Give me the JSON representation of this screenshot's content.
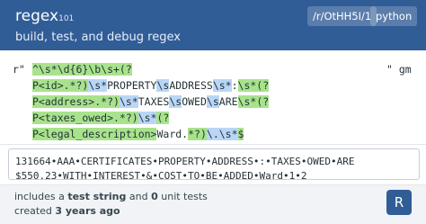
{
  "header": {
    "logo_main": "regex",
    "logo_sub": "101",
    "tagline": "build, test, and debug regex",
    "link_label": "/r/OtHH5I/1",
    "flavor_label": "python"
  },
  "regex": {
    "open_delim": "r\"",
    "flags": "\" gm",
    "lines": [
      [
        {
          "t": "^\\s*\\d{6}\\b\\s+(?",
          "c": "g"
        }
      ],
      [
        {
          "t": "P<id>.*?)",
          "c": "g"
        },
        {
          "t": "\\s*",
          "c": "b"
        },
        {
          "t": "PROPERTY",
          "c": ""
        },
        {
          "t": "\\s",
          "c": "b"
        },
        {
          "t": "ADDRESS",
          "c": ""
        },
        {
          "t": "\\s*",
          "c": "b"
        },
        {
          "t": ":",
          "c": ""
        },
        {
          "t": "\\s*(?",
          "c": "g"
        }
      ],
      [
        {
          "t": "P<address>.*?)",
          "c": "g"
        },
        {
          "t": "\\s*",
          "c": "b"
        },
        {
          "t": "TAXES",
          "c": ""
        },
        {
          "t": "\\s",
          "c": "b"
        },
        {
          "t": "OWED",
          "c": ""
        },
        {
          "t": "\\s",
          "c": "b"
        },
        {
          "t": "ARE",
          "c": ""
        },
        {
          "t": "\\s*(?",
          "c": "g"
        }
      ],
      [
        {
          "t": "P<taxes_owed>.*?)",
          "c": "g"
        },
        {
          "t": "\\s*",
          "c": "b"
        },
        {
          "t": "(?",
          "c": "g"
        }
      ],
      [
        {
          "t": "P<legal_description>",
          "c": "g"
        },
        {
          "t": "Ward.",
          "c": ""
        },
        {
          "t": "*?)",
          "c": "g"
        },
        {
          "t": "\\.",
          "c": "b"
        },
        {
          "t": "\\s*",
          "c": "b"
        },
        {
          "t": "$",
          "c": "g"
        }
      ]
    ]
  },
  "test_string": {
    "lines": [
      "131664•AAA•CERTIFICATES•PROPERTY•ADDRESS•:•TAXES•OWED•ARE",
      "$550.23•WITH•INTEREST•&•COST•TO•BE•ADDED•Ward•1•2"
    ]
  },
  "footer": {
    "line1_prefix": "includes a ",
    "line1_bold1": "test string",
    "line1_mid": " and ",
    "line1_bold2": "0",
    "line1_suffix": " unit tests",
    "line2_prefix": "created ",
    "line2_bold": "3 years ago"
  },
  "avatar": {
    "letter": "R"
  }
}
